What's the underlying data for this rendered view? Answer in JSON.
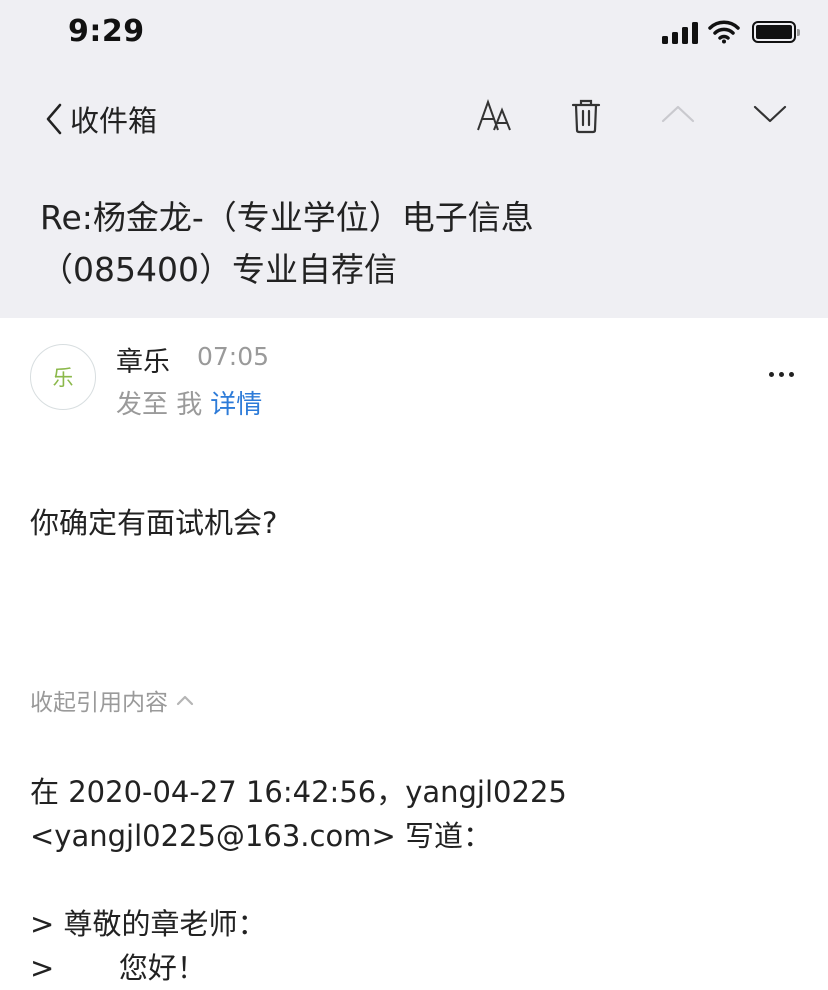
{
  "status_bar": {
    "time": "9:29"
  },
  "nav": {
    "back_label": "收件箱",
    "icons": [
      "font-size-icon",
      "trash-icon",
      "chevron-up-icon",
      "chevron-down-icon"
    ]
  },
  "email": {
    "subject_line1": "Re:杨金龙-（专业学位）电子信息",
    "subject_line2": "（085400）专业自荐信",
    "sender": {
      "avatar_char": "乐",
      "name": "章乐",
      "time": "07:05",
      "recipient_text": "发至 我",
      "details_label": "详情"
    },
    "body": "你确定有面试机会?",
    "collapse_quote_label": "收起引用内容",
    "quote": {
      "header_line1": "在 2020-04-27 16:42:56，yangjl0225",
      "header_line2": "<yangjl0225@163.com> 写道：",
      "lines": [
        "> 尊敬的章老师：",
        ">       您好！"
      ]
    }
  },
  "colors": {
    "header_bg": "#efeff3",
    "link_blue": "#2d7bd8",
    "muted_gray": "#9a9a9a",
    "avatar_green": "#8bb84a"
  }
}
